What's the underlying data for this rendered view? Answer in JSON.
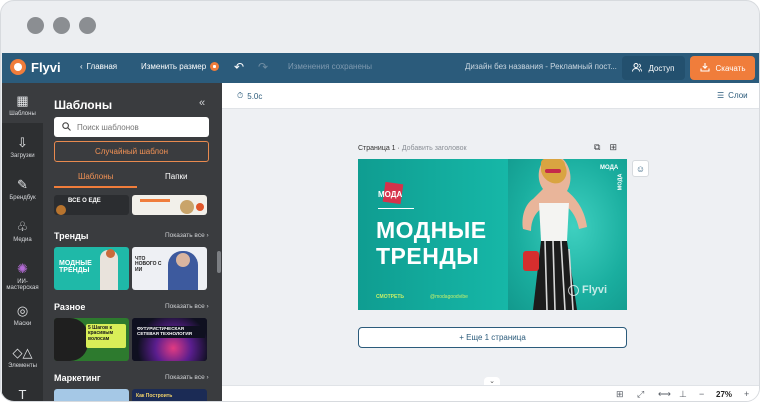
{
  "app": {
    "name": "Flyvi"
  },
  "topbar": {
    "back_label": "Главная",
    "resize_label": "Изменить размер",
    "undo_icon": "undo-icon",
    "redo_icon": "redo-icon",
    "status": "Изменения сохранены",
    "design_title": "Дизайн без названия - Рекламный пост...",
    "access_label": "Доступ",
    "download_label": "Скачать"
  },
  "rail": {
    "items": [
      {
        "label": "Шаблоны",
        "icon": "templates-icon"
      },
      {
        "label": "Загрузки",
        "icon": "upload-icon"
      },
      {
        "label": "Брендбук",
        "icon": "brandbook-icon"
      },
      {
        "label": "Медиа",
        "icon": "media-icon"
      },
      {
        "label": "ИИ-мастерская",
        "icon": "ai-workshop-icon"
      },
      {
        "label": "Маски",
        "icon": "masks-icon"
      },
      {
        "label": "Элементы",
        "icon": "elements-icon"
      },
      {
        "label": "",
        "icon": "text-icon"
      }
    ]
  },
  "panel": {
    "title": "Шаблоны",
    "search_placeholder": "Поиск шаблонов",
    "random_label": "Случайный шаблон",
    "tabs": [
      {
        "label": "Шаблоны"
      },
      {
        "label": "Папки"
      }
    ],
    "top_strip_text": "ВСЕ О ЕДЕ",
    "sections": [
      {
        "title": "Тренды",
        "show_all": "Показать все",
        "thumbs": [
          {
            "text": "МОДНЫЕ ТРЕНДЫ"
          },
          {
            "text": "ЧТО НОВОГО С ИИ"
          }
        ]
      },
      {
        "title": "Разное",
        "show_all": "Показать все",
        "thumbs": [
          {
            "text": "5 Шагов к красивым волосам"
          },
          {
            "text": "ФУТУРИСТИЧЕСКАЯ СЕТЕВАЯ ТЕХНОЛОГИЯ"
          }
        ]
      },
      {
        "title": "Маркетинг",
        "show_all": "Показать все",
        "thumbs": [
          {
            "text": ""
          },
          {
            "text": "Как Построить"
          }
        ]
      }
    ]
  },
  "workspace": {
    "timer": "5.0с",
    "layers_label": "Слои",
    "page_label": "Страница 1",
    "page_sub": "Добавить заголовок",
    "add_page_label": "+ Еще 1 страница",
    "zoom": "27%",
    "design": {
      "brand_badge": "МОДА",
      "brand_vertical": "МОДА",
      "heading_line1": "МОДНЫЕ",
      "heading_line2": "ТРЕНДЫ",
      "cta": "СМОТРЕТЬ",
      "handle": "@modagoodvibe",
      "watermark": "Flyvi"
    }
  },
  "colors": {
    "topbar": "#2b5b7b",
    "accent": "#f07d3b",
    "panel": "#3a3c3f",
    "rail": "#2d2f31",
    "design_bg": "#13b3a4"
  }
}
